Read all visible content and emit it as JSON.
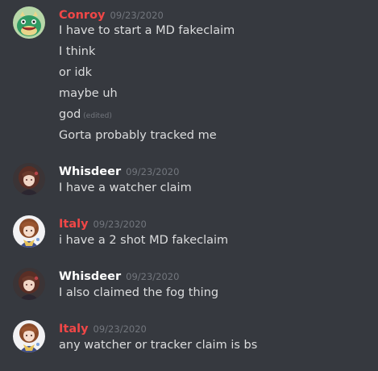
{
  "colors": {
    "background": "#36393f",
    "name_red": "#f04747",
    "name_white": "#ffffff",
    "text": "#dcddde",
    "timestamp": "#72767d"
  },
  "messages": [
    {
      "author": "Conroy",
      "timestamp": "09/23/2020",
      "avatar_icon": "green-dinosaur-avatar",
      "lines": [
        {
          "text": "I have to start a MD fakeclaim"
        },
        {
          "text": "I think"
        },
        {
          "text": "or idk"
        },
        {
          "text": "maybe uh"
        },
        {
          "text": "god",
          "edited": "(edited)"
        },
        {
          "text": "Gorta probably tracked me"
        }
      ]
    },
    {
      "author": "Whisdeer",
      "timestamp": "09/23/2020",
      "avatar_icon": "anime-girl-dark-avatar",
      "lines": [
        {
          "text": "I have a watcher claim"
        }
      ]
    },
    {
      "author": "Italy",
      "timestamp": "09/23/2020",
      "avatar_icon": "anime-girl-light-avatar",
      "lines": [
        {
          "text": "i have a 2 shot MD fakeclaim"
        }
      ]
    },
    {
      "author": "Whisdeer",
      "timestamp": "09/23/2020",
      "avatar_icon": "anime-girl-dark-avatar",
      "lines": [
        {
          "text": "I also claimed the fog thing"
        }
      ]
    },
    {
      "author": "Italy",
      "timestamp": "09/23/2020",
      "avatar_icon": "anime-girl-light-avatar",
      "lines": [
        {
          "text": "any watcher or tracker claim is bs"
        }
      ]
    }
  ]
}
